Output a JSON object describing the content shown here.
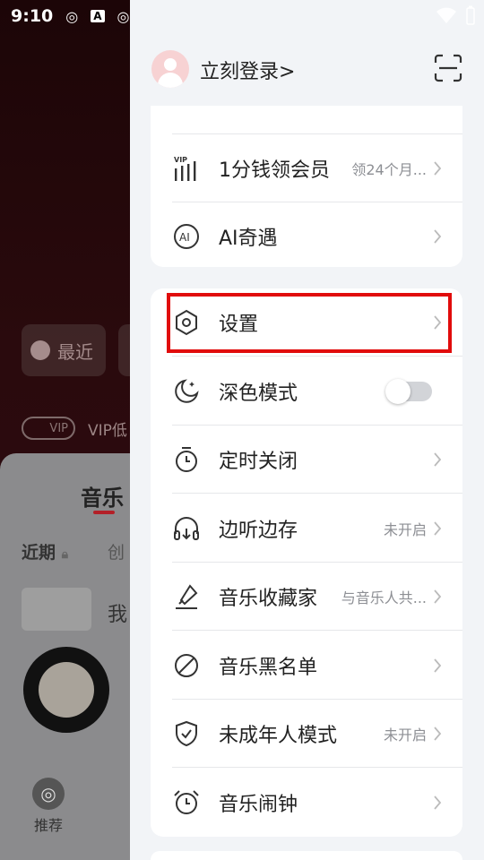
{
  "status_bar": {
    "time": "9:10"
  },
  "background": {
    "recent_chip": "最近",
    "vip_badge": "VIP",
    "vip_text": "VIP低",
    "tab_title": "音乐",
    "filter_recent": "近期",
    "filter_created": "创",
    "row_text": "我",
    "nav_recommend": "推荐"
  },
  "drawer": {
    "login_text": "立刻登录",
    "login_chevron": ">",
    "card1": [
      {
        "label": "1分钱领会员",
        "sub": "领24个月...",
        "icon": "vip-bars-icon"
      },
      {
        "label": "AI奇遇",
        "sub": "",
        "icon": "ai-circle-icon"
      }
    ],
    "card2": [
      {
        "label": "设置",
        "sub": "",
        "icon": "hexagon-settings-icon"
      },
      {
        "label": "深色模式",
        "sub": "",
        "icon": "moon-icon",
        "toggle": false
      },
      {
        "label": "定时关闭",
        "sub": "",
        "icon": "timer-icon"
      },
      {
        "label": "边听边存",
        "sub": "未开启",
        "icon": "headphones-download-icon"
      },
      {
        "label": "音乐收藏家",
        "sub": "与音乐人共...",
        "icon": "collector-icon"
      },
      {
        "label": "音乐黑名单",
        "sub": "",
        "icon": "block-icon"
      },
      {
        "label": "未成年人模式",
        "sub": "未开启",
        "icon": "shield-check-icon"
      },
      {
        "label": "音乐闹钟",
        "sub": "",
        "icon": "alarm-icon"
      }
    ]
  },
  "colors": {
    "highlight": "#e10c0c",
    "accent": "#b32028"
  }
}
